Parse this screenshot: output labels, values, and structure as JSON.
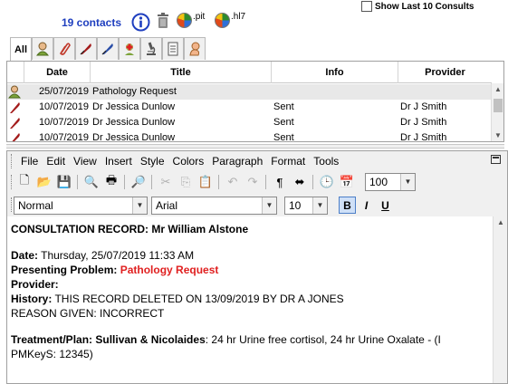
{
  "header": {
    "contacts_label": "19 contacts",
    "show_last_label": "Show Last 10 Consults",
    "show_last_checked": false,
    "pit_label": ".pit",
    "hl7_label": ".hl7"
  },
  "tabs": {
    "all_label": "All",
    "icons": [
      "patient-icon",
      "paperclip-icon",
      "quill-red-icon",
      "quill-blue-icon",
      "medical-cross-icon",
      "microscope-icon",
      "document-icon",
      "baby-icon"
    ]
  },
  "grid": {
    "columns": [
      "",
      "Date",
      "Title",
      "Info",
      "Provider"
    ],
    "rows": [
      {
        "icon": "patient-icon",
        "date": "25/07/2019",
        "title": "Pathology Request",
        "info": "",
        "provider": "",
        "selected": true
      },
      {
        "icon": "quill-icon",
        "date": "10/07/2019",
        "title": "Dr Jessica Dunlow",
        "info": "Sent",
        "provider": "Dr J Smith",
        "selected": false
      },
      {
        "icon": "quill-icon",
        "date": "10/07/2019",
        "title": "Dr Jessica Dunlow",
        "info": "Sent",
        "provider": "Dr J Smith",
        "selected": false
      },
      {
        "icon": "quill-icon",
        "date": "10/07/2019",
        "title": "Dr Jessica Dunlow",
        "info": "Sent",
        "provider": "Dr J Smith",
        "selected": false
      }
    ]
  },
  "editor": {
    "menu": [
      "File",
      "Edit",
      "View",
      "Insert",
      "Style",
      "Colors",
      "Paragraph",
      "Format",
      "Tools"
    ],
    "zoom": "100",
    "style": "Normal",
    "font": "Arial",
    "size": "10",
    "format_buttons": {
      "bold": "B",
      "italic": "I",
      "underline": "U"
    }
  },
  "document": {
    "heading": "CONSULTATION RECORD: Mr William Alstone",
    "date_label": "Date:",
    "date_value": " Thursday, 25/07/2019  11:33 AM",
    "problem_label": "Presenting Problem:",
    "problem_value": "Pathology Request",
    "provider_label": "Provider:",
    "history_label": "History:",
    "history_value": "  THIS RECORD DELETED ON 13/09/2019 BY DR A JONES",
    "reason_line": "REASON GIVEN: INCORRECT",
    "treatment_label": "Treatment/Plan:",
    "treatment_bold": "  Sullivan & Nicolaides",
    "treatment_value": ": 24 hr Urine free cortisol, 24 hr Urine Oxalate - (I",
    "pmkeys_line": "PMKeyS: 12345)"
  }
}
